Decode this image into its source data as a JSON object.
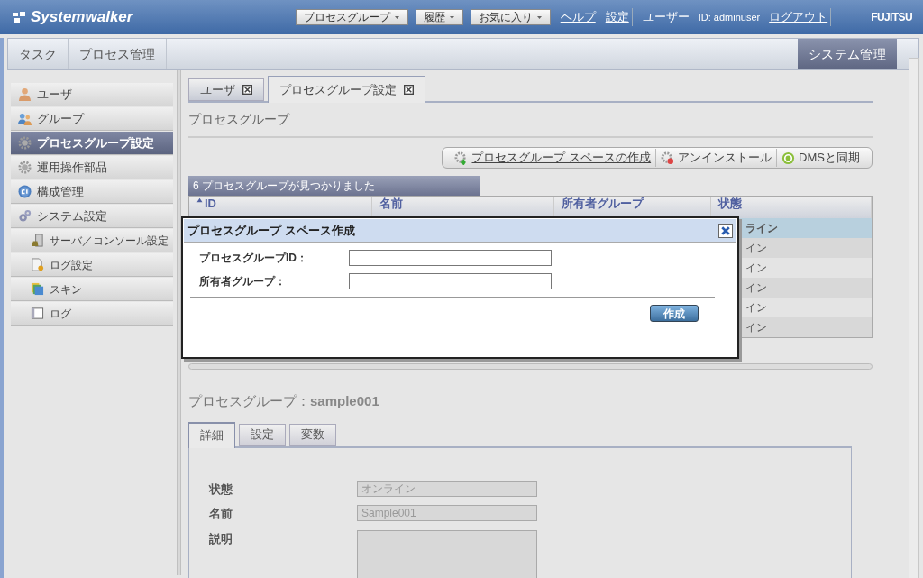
{
  "header": {
    "logo": "Systemwalker",
    "menus": [
      {
        "label": "プロセスグループ",
        "kind": "dropdown"
      },
      {
        "label": "履歴",
        "kind": "dropdown"
      },
      {
        "label": "お気に入り",
        "kind": "dropdown"
      },
      {
        "label": "ヘルプ",
        "kind": "link"
      },
      {
        "label": "設定",
        "kind": "link"
      },
      {
        "label": "ユーザー",
        "kind": "text"
      },
      {
        "label": "ID: adminuser",
        "kind": "text"
      },
      {
        "label": "ログアウト",
        "kind": "link"
      }
    ],
    "brand": "FUJITSU"
  },
  "main_tabs": [
    {
      "label": "タスク",
      "selected": false
    },
    {
      "label": "プロセス管理",
      "selected": false
    },
    {
      "label": "システム管理",
      "selected": true
    }
  ],
  "sidebar": {
    "items": [
      {
        "label": "ユーザ",
        "selected": false
      },
      {
        "label": "グループ",
        "selected": false
      },
      {
        "label": "プロセスグループ設定",
        "selected": true
      },
      {
        "label": "運用操作部品",
        "selected": false
      },
      {
        "label": "構成管理",
        "selected": false
      },
      {
        "label": "システム設定",
        "selected": false,
        "children": [
          {
            "label": "サーバ／コンソール設定",
            "selected": false
          },
          {
            "label": "ログ設定",
            "selected": false
          },
          {
            "label": "スキン",
            "selected": false
          },
          {
            "label": "ログ",
            "selected": false
          }
        ]
      }
    ]
  },
  "content_tabs": [
    {
      "label": "ユーザ",
      "selected": false
    },
    {
      "label": "プロセスグループ設定",
      "selected": true
    }
  ],
  "section_title": "プロセスグループ",
  "toolbar": [
    {
      "label": "プロセスグループ スペースの作成",
      "link": true
    },
    {
      "label": "アンインストール",
      "link": false
    },
    {
      "label": "DMSと同期",
      "link": false
    }
  ],
  "result_banner": "6 プロセスグループが見つかりました",
  "table": {
    "columns": [
      "ID",
      "名前",
      "所有者グループ",
      "状態"
    ],
    "rows": [
      {
        "status": "ライン",
        "selected": true
      },
      {
        "status": "イン",
        "selected": false
      },
      {
        "status": "イン",
        "selected": false
      },
      {
        "status": "イン",
        "selected": false
      },
      {
        "status": "イン",
        "selected": false
      },
      {
        "status": "イン",
        "selected": false
      }
    ]
  },
  "dialog": {
    "title": "プロセスグループ スペース作成",
    "fields": [
      {
        "label": "プロセスグループID："
      },
      {
        "label": "所有者グループ："
      }
    ],
    "button": "作成"
  },
  "detail": {
    "title": "プロセスグループ：",
    "name": "sample001",
    "tabs": [
      {
        "label": "詳細",
        "selected": true
      },
      {
        "label": "設定",
        "selected": false
      },
      {
        "label": "変数",
        "selected": false
      }
    ],
    "fields": [
      {
        "label": "状態",
        "value": "オンライン",
        "kind": "input"
      },
      {
        "label": "名前",
        "value": "Sample001",
        "kind": "input"
      },
      {
        "label": "説明",
        "kind": "textarea"
      }
    ]
  }
}
